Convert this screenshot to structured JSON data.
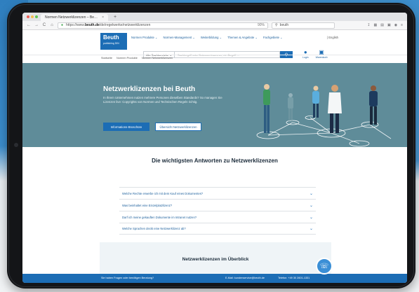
{
  "browser": {
    "tab_title": "Normen Netzwerklizenzen – Be…",
    "tab_close": "×",
    "new_tab": "+",
    "url_prefix": "https://www.",
    "url_domain": "beuth.de",
    "url_path": "/de/regelwerke/netzwerklizenzen",
    "zoom": "90%",
    "search_placeholder": "beuth",
    "nav_back": "←",
    "nav_forward": "→",
    "nav_reload": "C",
    "nav_home": "⌂"
  },
  "site": {
    "logo_name": "Beuth",
    "logo_sub": "publishing DIN",
    "nav_items": [
      "Normen Produkte ⌄",
      "Normen-Management ⌄",
      "Weiterbildung ⌄",
      "Themen & Angebote ⌄",
      "Fachgebiete ⌄"
    ],
    "language": "| English",
    "search_category": "Alle Suchbereiche",
    "search_placeholder": "Suchbegriff oder Dokumentnummer, ein Begriff ...",
    "search_button_icon": "magnifier-icon",
    "login_label": "Login",
    "cart_label": "Warenkorb",
    "breadcrumb": [
      "Startseite",
      "Normen Produkte",
      "Normen Netzwerklizenzen"
    ]
  },
  "hero": {
    "title": "Netzwerklizenzen bei Beuth",
    "text": "In Ihrem Unternehmen nutzen mehrere Personen dieselben Standards? So managen Sie Lizenzen live: Copyrights von Normen und Technischen Regeln richtig.",
    "primary_button": "Informations-Broschüre",
    "secondary_button": "Übersicht Netzwerklizenzen",
    "accent_color": "#1c6db5",
    "background_color": "#5f8c99"
  },
  "faq": {
    "title": "Die wichtigsten Antworten zu Netzwerklizenzen",
    "items": [
      "Welche Rechte erwerbe ich mit dem Kauf eines Dokumentes?",
      "Was beinhaltet eine Einzelplatzlizenz?",
      "Darf ich meine gekauften Dokumente im Intranet nutzen?",
      "Welche Sprachen deckt eine Netzwerklizenz ab?"
    ]
  },
  "overview": {
    "title": "Netzwerklizenzen im Überblick"
  },
  "footer": {
    "question": "Sie haben Fragen oder benötigen Beratung?",
    "contact": "E-Mail: kundenservice@beuth.de",
    "phone": "Telefon: +49 30 2601-1331"
  }
}
